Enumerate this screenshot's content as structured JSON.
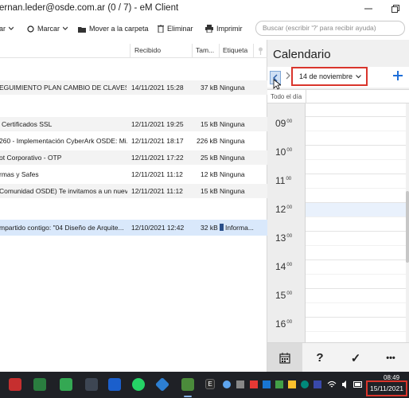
{
  "window": {
    "title": "ernan.leder@osde.com.ar (0 / 7) - eM Client"
  },
  "toolbar": {
    "reply_partial": "ar",
    "mark_label": "Marcar",
    "move_label": "Mover a la carpeta",
    "delete_label": "Eliminar",
    "print_label": "Imprimir",
    "search_placeholder": "Buscar (escribir '?' para recibir ayuda)"
  },
  "list": {
    "columns": {
      "received": "Recibido",
      "size": "Tam...",
      "tag": "Etiqueta"
    },
    "rows": [
      {
        "subject": "EGUIMIENTO PLAN CAMBIO DE CLAVES I...",
        "received": "14/11/2021 15:28",
        "size": "37 kB",
        "tag": "Ninguna"
      },
      {
        "subject": "Certificados SSL",
        "received": "12/11/2021 19:25",
        "size": "15 kB",
        "tag": "Ninguna"
      },
      {
        "subject": "260 - Implementación CyberArk OSDE: Mi...",
        "received": "12/11/2021 18:17",
        "size": "226 kB",
        "tag": "Ninguna"
      },
      {
        "subject": "ot Corporativo - OTP",
        "received": "12/11/2021 17:22",
        "size": "25 kB",
        "tag": "Ninguna"
      },
      {
        "subject": "rmas y Safes",
        "received": "12/11/2021 11:12",
        "size": "12 kB",
        "tag": "Ninguna"
      },
      {
        "subject": "Comunidad OSDE) Te invitamos a un nuev...",
        "received": "12/11/2021 11:12",
        "size": "15 kB",
        "tag": "Ninguna"
      },
      {
        "subject": "mpartido contigo: \"04 Diseño de Arquite...",
        "received": "12/10/2021 12:42",
        "size": "32 kB",
        "tag": "Informa..."
      }
    ]
  },
  "calendar": {
    "title": "Calendario",
    "date_label": "14 de noviembre",
    "allday_label": "Todo el día",
    "hours": [
      {
        "h": "09",
        "m": "00"
      },
      {
        "h": "10",
        "m": "00"
      },
      {
        "h": "11",
        "m": "00"
      },
      {
        "h": "12",
        "m": "00"
      },
      {
        "h": "13",
        "m": "00"
      },
      {
        "h": "14",
        "m": "00"
      },
      {
        "h": "15",
        "m": "00"
      },
      {
        "h": "16",
        "m": "00"
      }
    ],
    "bottom": {
      "help": "?",
      "tasks": "✓",
      "more": "•••"
    }
  },
  "taskbar": {
    "time": "08:49",
    "date": "15/11/2021",
    "e_label": "E"
  },
  "colors": {
    "selected_row": "#d9e8fb",
    "highlight_border": "#d9352c",
    "accent_blue": "#1e6fd9"
  }
}
